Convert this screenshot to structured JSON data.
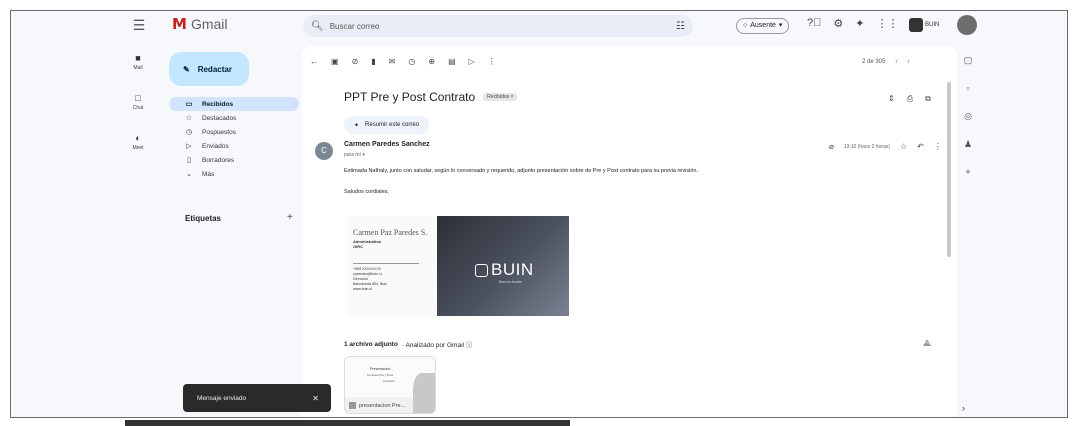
{
  "app": {
    "name": "Gmail"
  },
  "search": {
    "placeholder": "Buscar correo"
  },
  "status": {
    "label": "Ausente"
  },
  "org_logo_text": "BUIN",
  "rail": [
    {
      "label": "Mail",
      "icon": "mail-icon"
    },
    {
      "label": "Chat",
      "icon": "chat-icon"
    },
    {
      "label": "Meet",
      "icon": "meet-icon"
    }
  ],
  "compose": {
    "label": "Redactar"
  },
  "nav": [
    {
      "label": "Recibidos",
      "icon": "inbox-icon"
    },
    {
      "label": "Destacados",
      "icon": "star-icon"
    },
    {
      "label": "Pospuestos",
      "icon": "clock-icon"
    },
    {
      "label": "Enviados",
      "icon": "send-icon"
    },
    {
      "label": "Borradores",
      "icon": "draft-icon"
    },
    {
      "label": "Más",
      "icon": "chevron-down-icon"
    }
  ],
  "labels": {
    "heading": "Etiquetas"
  },
  "pager": {
    "text": "2 de 305"
  },
  "email": {
    "subject": "PPT Pre y Post Contrato",
    "label_chip": "Recibidos ×",
    "summarize_label": "Resumir este correo",
    "sender_initial": "C",
    "sender_name": "Carmen Paredes Sanchez",
    "to": "para mí ▾",
    "time": "13:10 (hace 2 horas)",
    "body_line1": "Estimada Nathaly, junto con saludar, según lo conversado y requerido, adjunto presentación sobre de Pre y Post contrato para su previa revisión.",
    "body_line2": "Saludos cordiales,"
  },
  "signature": {
    "name": "Carmen Paz Paredes S.",
    "role": "Administrativa",
    "dept": "OIRC",
    "details": [
      "+569 XXXXXXXX",
      "cparedes@buin.cl",
      "Dirección",
      "Balmaceda 554, Buin",
      "www.buin.cl"
    ],
    "brand": "BUIN",
    "brand_sub": "Buin en Acción"
  },
  "attachment": {
    "count_label": "1 archivo adjunto",
    "scan_label": "· Analizado por Gmail ⓘ",
    "filename": "presentacion Pre...",
    "thumb_line1": "Presentación",
    "thumb_line2": "Contrato Pre y Post",
    "thumb_line3": "Contrato"
  },
  "snackbar": {
    "message": "Mensaje enviado",
    "close": "✕"
  }
}
